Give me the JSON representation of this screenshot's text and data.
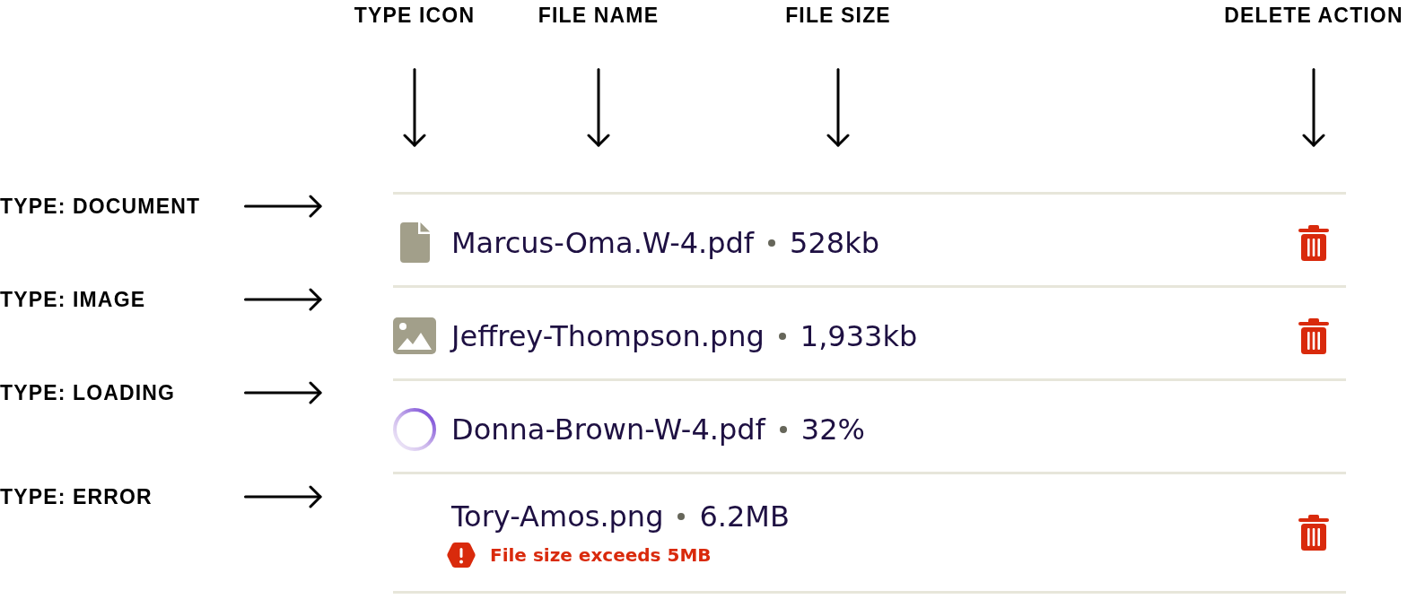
{
  "column_callouts": [
    {
      "label": "TYPE ICON"
    },
    {
      "label": "FILE NAME"
    },
    {
      "label": "FILE SIZE"
    },
    {
      "label": "DELETE ACTION"
    }
  ],
  "files": [
    {
      "kind": "document",
      "callout": "TYPE: DOCUMENT",
      "name": "Marcus-Oma.W-4.pdf",
      "size": "528kb",
      "deletable": true
    },
    {
      "kind": "image",
      "callout": "TYPE: IMAGE",
      "name": "Jeffrey-Thompson.png",
      "size": "1,933kb",
      "deletable": true
    },
    {
      "kind": "loading",
      "callout": "TYPE: LOADING",
      "name": "Donna-Brown-W-4.pdf",
      "size": "32%",
      "deletable": false
    },
    {
      "kind": "error",
      "callout": "TYPE: ERROR",
      "name": "Tory-Amos.png",
      "size": "6.2MB",
      "error": "File size exceeds 5MB",
      "deletable": true
    }
  ]
}
